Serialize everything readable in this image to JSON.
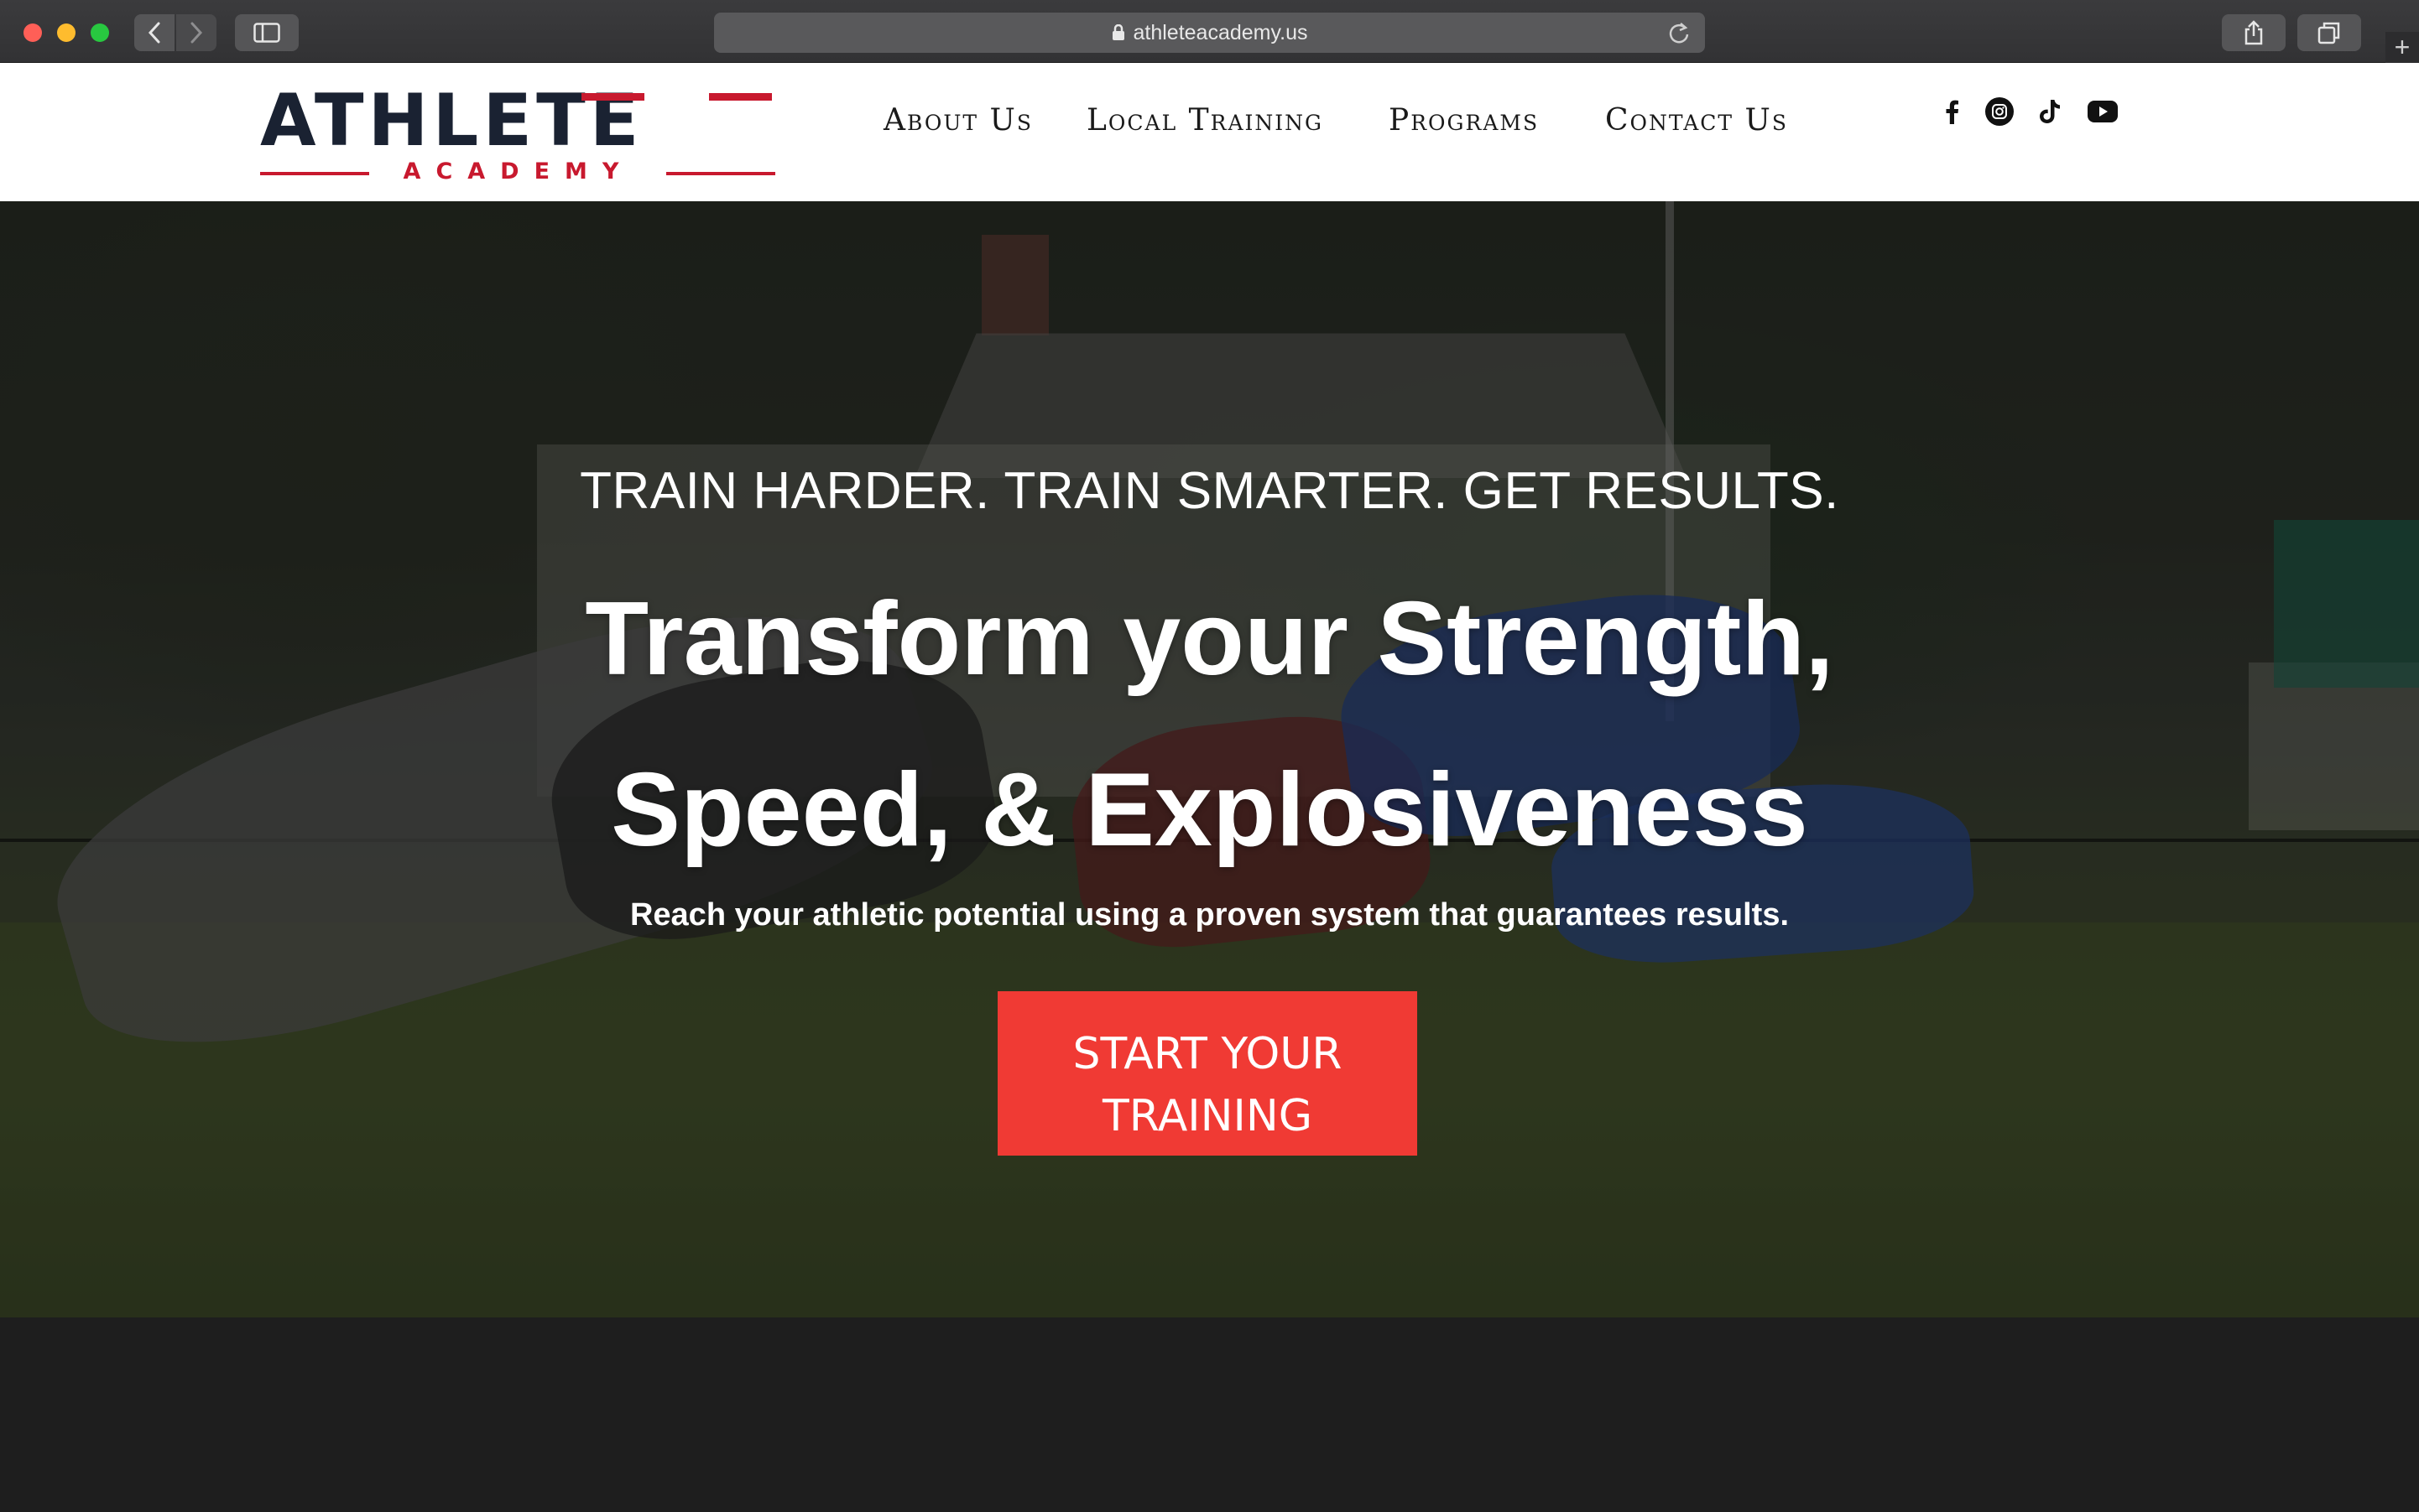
{
  "browser": {
    "url": "athleteacademy.us",
    "icons": {
      "back": "chevron-left-icon",
      "forward": "chevron-right-icon",
      "sidebar": "sidebar-icon",
      "lock": "lock-icon",
      "reload": "reload-icon",
      "share": "share-icon",
      "tabs": "tabs-overview-icon",
      "new_tab": "plus-icon"
    }
  },
  "site": {
    "logo": {
      "word": "ATHLETE",
      "sub": "ACADEMY",
      "colors": {
        "navy": "#1a2232",
        "red": "#c8192e"
      }
    },
    "nav": [
      {
        "label": "About Us"
      },
      {
        "label": "Local Training"
      },
      {
        "label": "Programs"
      },
      {
        "label": "Contact Us"
      }
    ],
    "social": [
      "facebook-icon",
      "instagram-icon",
      "tiktok-icon",
      "youtube-icon"
    ]
  },
  "hero": {
    "kicker": "TRAIN HARDER. TRAIN SMARTER. GET RESULTS.",
    "title_line1": "Transform your Strength,",
    "title_line2": "Speed, & Explosiveness",
    "subtitle": "Reach your athletic potential using a proven system that guarantees results.",
    "cta_line1": "START YOUR",
    "cta_line2": "TRAINING",
    "cta_color": "#f03a34"
  }
}
